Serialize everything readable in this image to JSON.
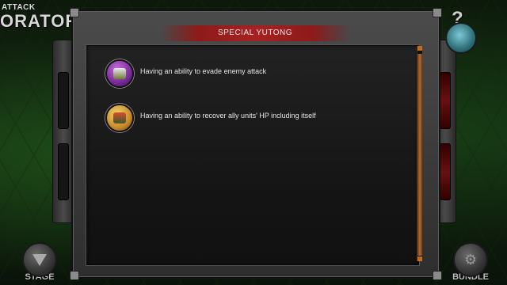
{
  "header": {
    "small_title": "ATTACK",
    "big_title": "ORATOR"
  },
  "dialog": {
    "title": "SPECIAL YUTONG",
    "abilities": [
      {
        "icon": "evade-ability-icon",
        "text": "Having an ability to evade enemy attack"
      },
      {
        "icon": "heal-ability-icon",
        "text": "Having an ability to recover ally units' HP including itself"
      }
    ]
  },
  "help": {
    "symbol": "?"
  },
  "bottom_buttons": {
    "stage_label": "STAGE",
    "bundle_label": "BUNDLE"
  },
  "colors": {
    "title_bar": "#a52222",
    "scroll_thumb": "#b86a28",
    "background_green": "#122611"
  }
}
